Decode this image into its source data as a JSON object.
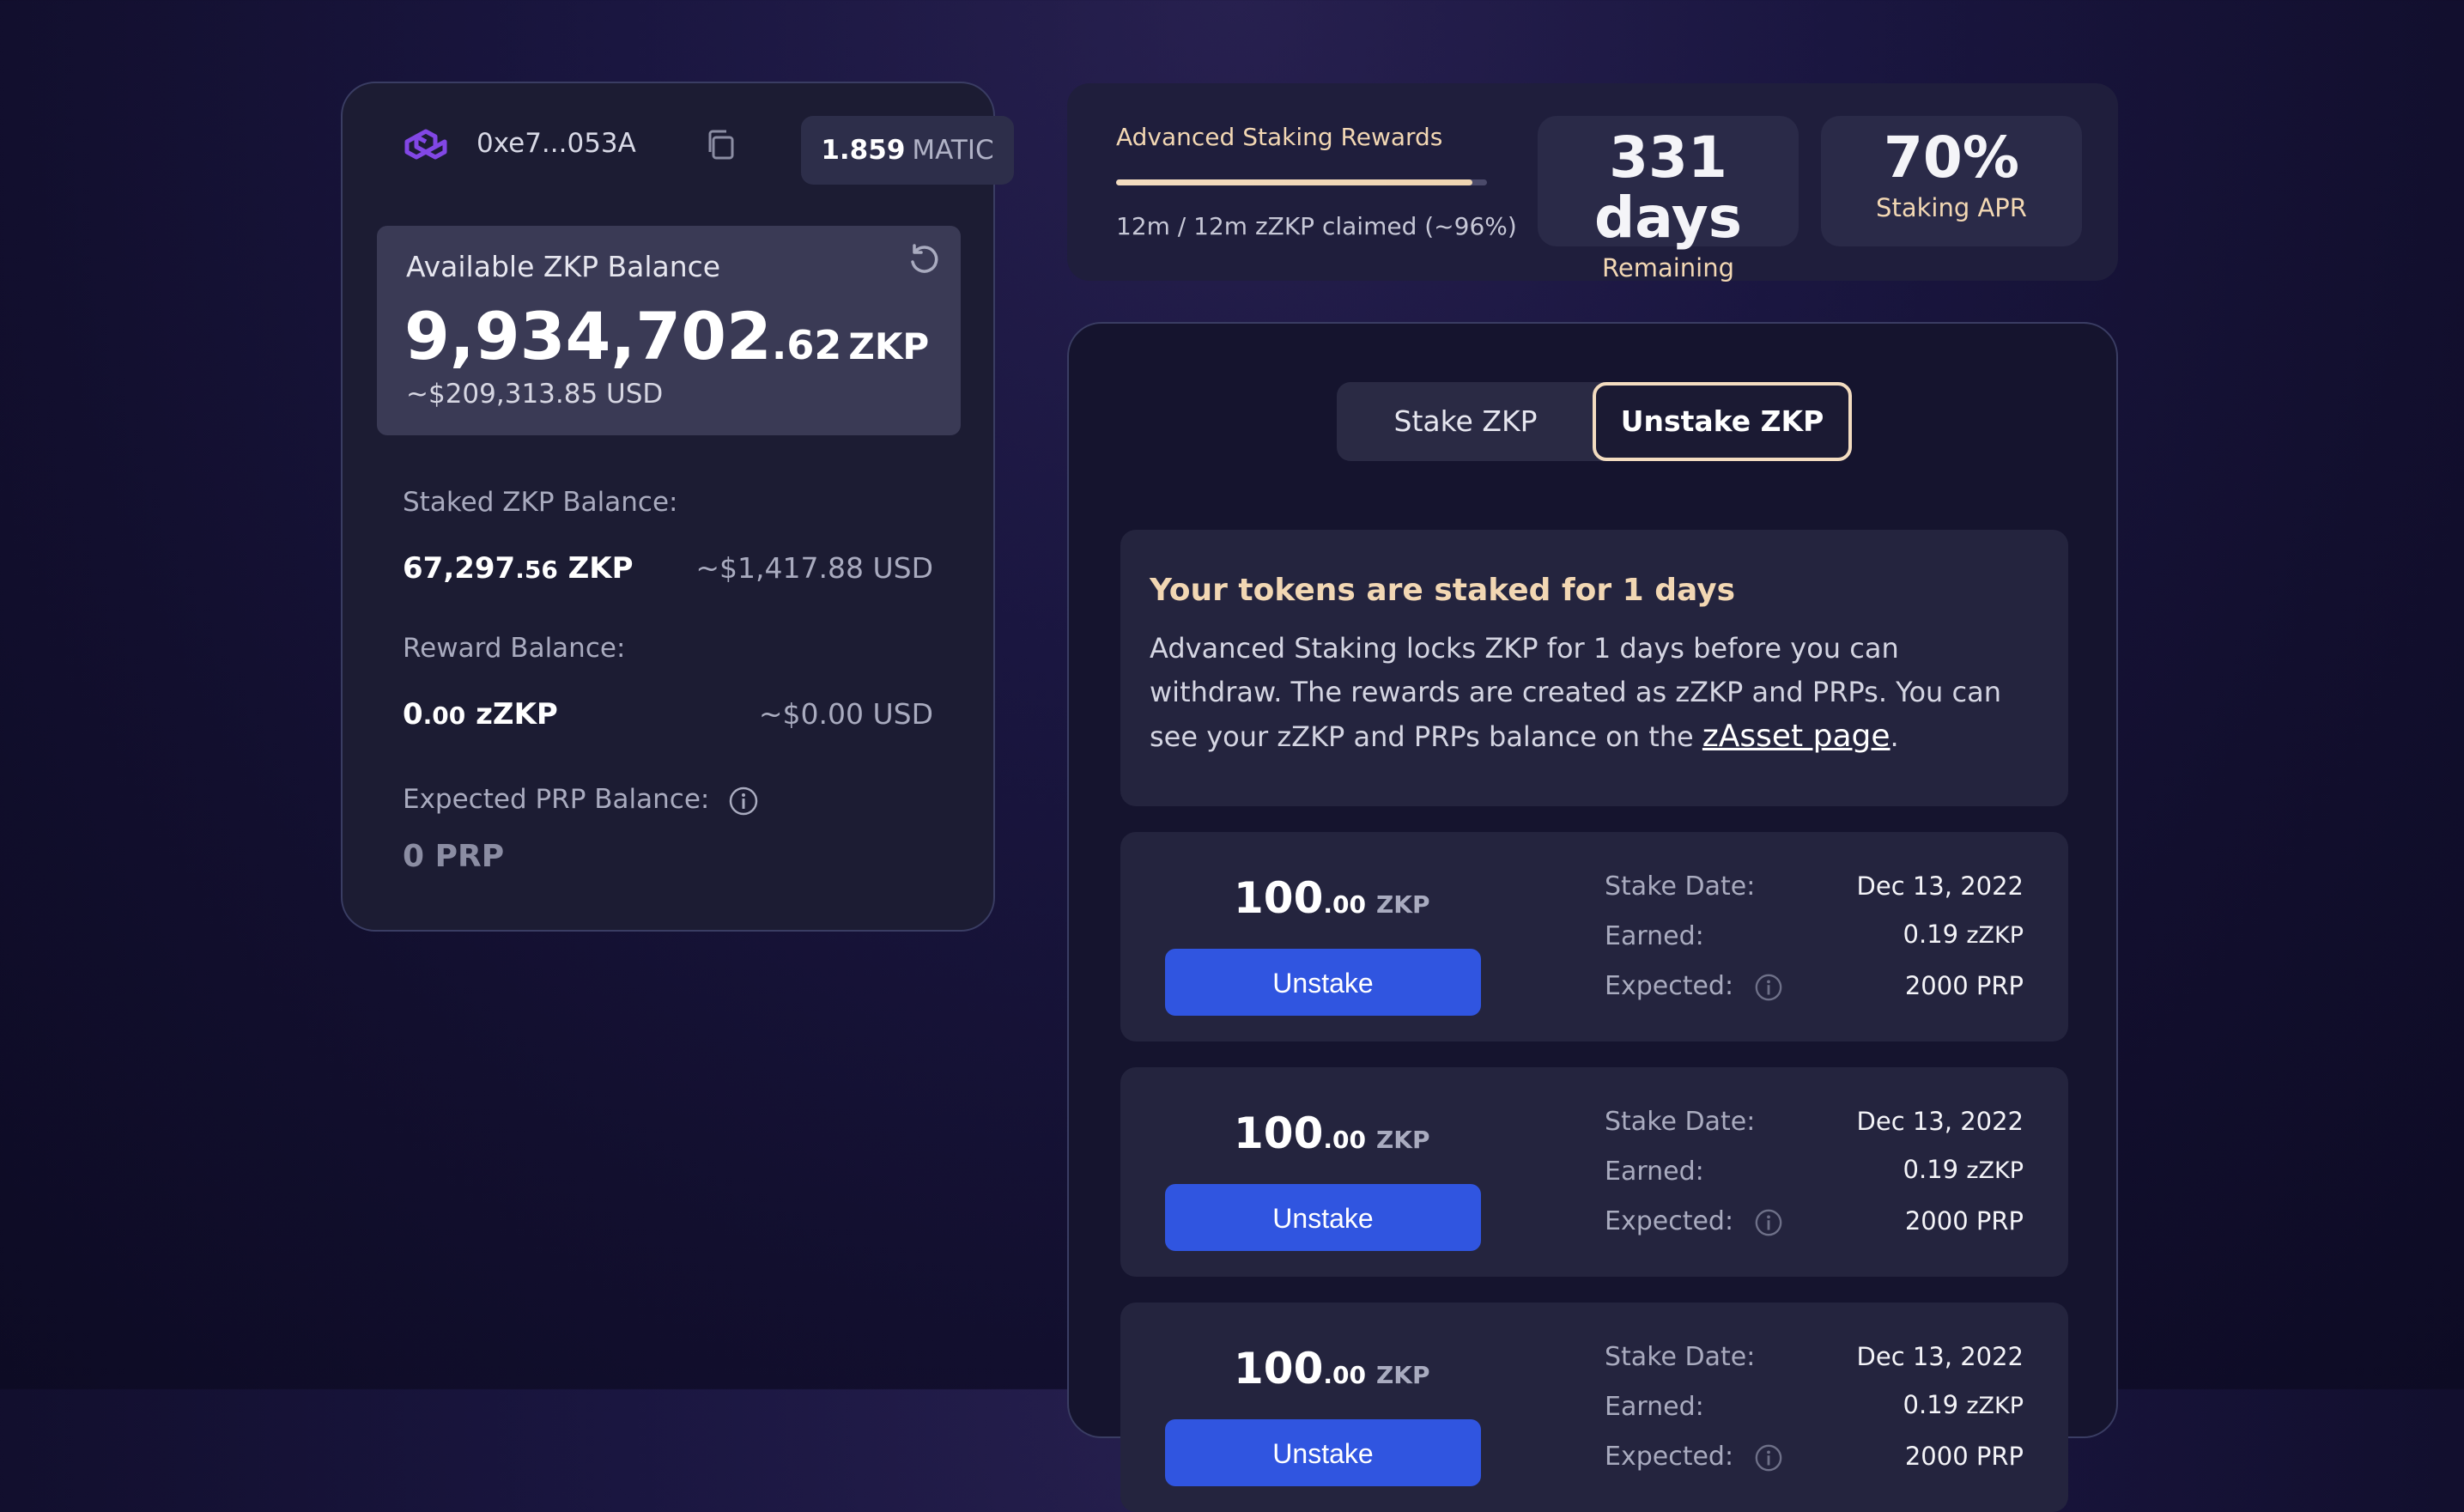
{
  "wallet": {
    "address": "0xe7...053A",
    "matic_amount": "1.859",
    "matic_unit": "MATIC",
    "available_label": "Available ZKP Balance",
    "available_int": "9,934,702",
    "available_dec": ".62",
    "available_unit": "ZKP",
    "available_usd": "~$209,313.85 USD",
    "staked_label": "Staked ZKP Balance:",
    "staked_int": "67,297",
    "staked_dec": ".56",
    "staked_unit": "ZKP",
    "staked_usd": "~$1,417.88 USD",
    "reward_label": "Reward Balance:",
    "reward_int": "0",
    "reward_dec": ".00",
    "reward_unit": "zZKP",
    "reward_usd": "~$0.00 USD",
    "prp_label": "Expected PRP Balance:",
    "prp_value": "0 PRP"
  },
  "rewards": {
    "title": "Advanced Staking Rewards",
    "claimed_text": "12m / 12m zZKP claimed (~96%)",
    "progress_fraction": 0.96,
    "remaining_value": "331 days",
    "remaining_label": "Remaining",
    "apr_value": "70%",
    "apr_label": "Staking APR"
  },
  "tabs": {
    "stake": "Stake ZKP",
    "unstake": "Unstake ZKP",
    "active": "unstake"
  },
  "notice": {
    "title": "Your tokens are staked for 1 days",
    "body": "Advanced Staking locks ZKP for 1 days before you can withdraw. The rewards are created as zZKP and PRPs. You can see your zZKP and PRPs balance on the ",
    "link_text": "zAsset page",
    "end": "."
  },
  "stakes": [
    {
      "int": "100",
      "dec": ".00",
      "unit": "ZKP",
      "button": "Unstake",
      "date_label": "Stake Date:",
      "date": "Dec 13, 2022",
      "earned_label": "Earned:",
      "earned": "0.19",
      "earned_unit": "zZKP",
      "expected_label": "Expected:",
      "expected": "2000 PRP"
    },
    {
      "int": "100",
      "dec": ".00",
      "unit": "ZKP",
      "button": "Unstake",
      "date_label": "Stake Date:",
      "date": "Dec 13, 2022",
      "earned_label": "Earned:",
      "earned": "0.19",
      "earned_unit": "zZKP",
      "expected_label": "Expected:",
      "expected": "2000 PRP"
    },
    {
      "int": "100",
      "dec": ".00",
      "unit": "ZKP",
      "button": "Unstake",
      "date_label": "Stake Date:",
      "date": "Dec 13, 2022",
      "earned_label": "Earned:",
      "earned": "0.19",
      "earned_unit": "zZKP",
      "expected_label": "Expected:",
      "expected": "2000 PRP"
    }
  ],
  "colors": {
    "accent_button": "#3055e0",
    "gold": "#f2d7b3",
    "polygon_purple": "#8247e5"
  }
}
